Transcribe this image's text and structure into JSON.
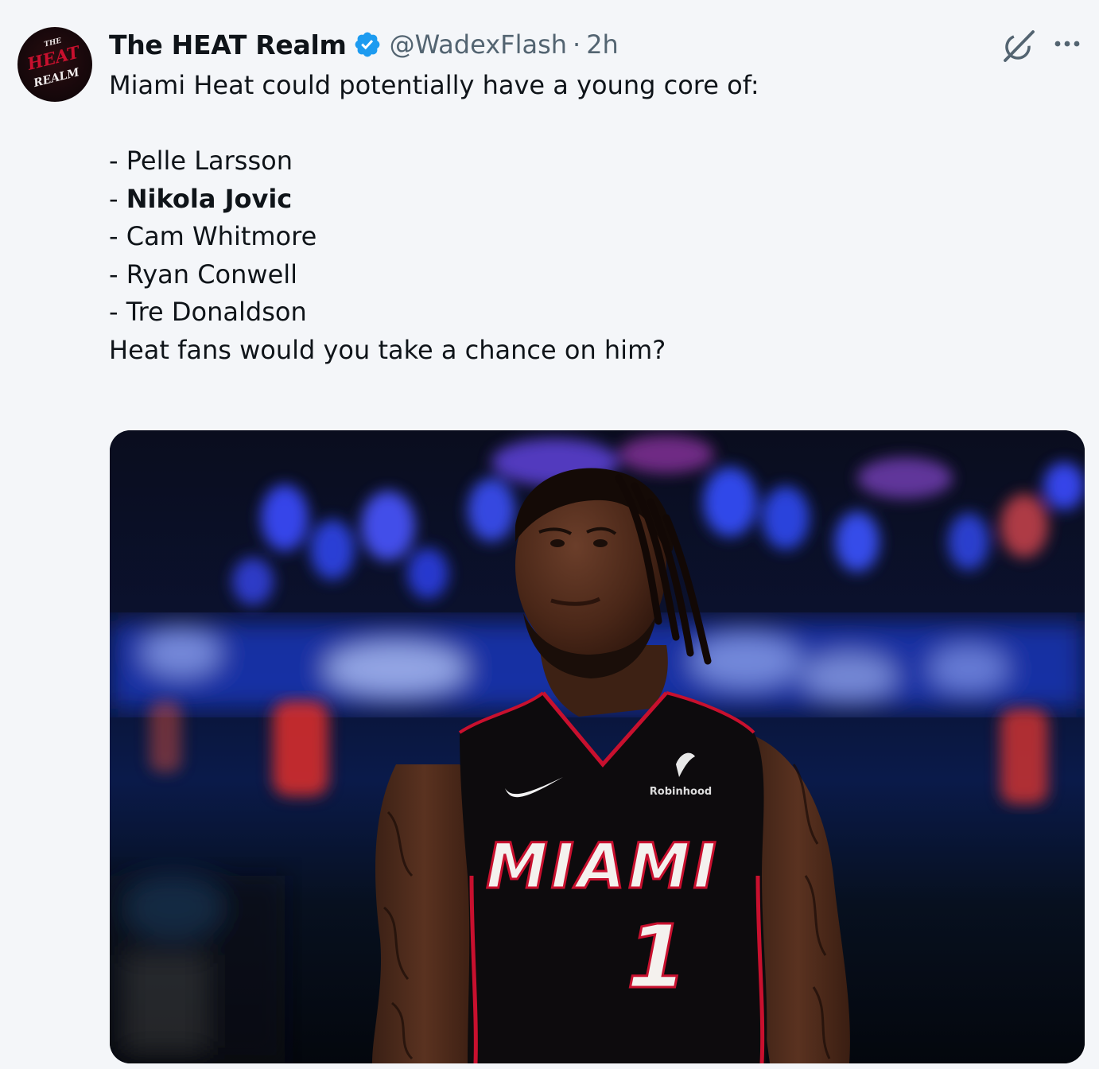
{
  "tweet": {
    "display_name": "The HEAT Realm",
    "handle": "@WadexFlash",
    "separator": "·",
    "time": "2h",
    "avatar_text": [
      "THE",
      "HEAT",
      "REALM"
    ],
    "text_intro": "Miami Heat could potentially have a young core of:",
    "list": [
      "- Pelle Larsson",
      "Nikola Jovic",
      "- Cam Whitmore",
      "- Ryan Conwell",
      "- Tre Donaldson"
    ],
    "list_bold_prefix": "- ",
    "closing": "Heat fans would you take a chance on him?",
    "media": {
      "jersey_text": "MIAMI",
      "jersey_number": "1",
      "sponsor": "Robinhood"
    },
    "icons": {
      "verified": "verified-badge-icon",
      "grok": "grok-icon",
      "more": "more-options-icon"
    },
    "colors": {
      "verified": "#1d9bf0",
      "heat_red": "#c8102e"
    }
  }
}
